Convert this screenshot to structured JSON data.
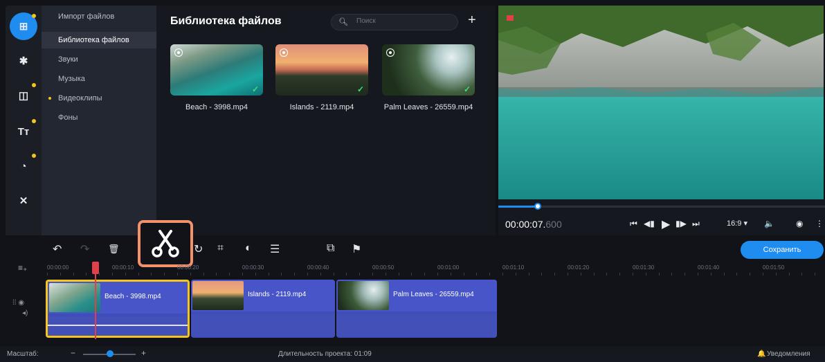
{
  "sidebar": {
    "icons": [
      {
        "name": "import-icon",
        "glyph": "⊞",
        "active": true,
        "dot": true
      },
      {
        "name": "pin-icon",
        "glyph": "✱",
        "active": false,
        "dot": false
      },
      {
        "name": "transitions-icon",
        "glyph": "◫",
        "active": false,
        "dot": true
      },
      {
        "name": "titles-icon",
        "glyph": "Tт",
        "active": false,
        "dot": true
      },
      {
        "name": "filters-icon",
        "glyph": "◔",
        "active": false,
        "dot": true
      },
      {
        "name": "tools-icon",
        "glyph": "✕",
        "active": false,
        "dot": false
      }
    ]
  },
  "categories": {
    "items": [
      {
        "label": "Импорт файлов"
      },
      {
        "label": "Библиотека файлов"
      },
      {
        "label": "Звуки"
      },
      {
        "label": "Музыка"
      },
      {
        "label": "Видеоклипы"
      },
      {
        "label": "Фоны"
      }
    ]
  },
  "library": {
    "title": "Библиотека файлов",
    "search_placeholder": "Поиск",
    "add_glyph": "+",
    "files": [
      {
        "name": "Beach - 3998.mp4"
      },
      {
        "name": "Islands - 2119.mp4"
      },
      {
        "name": "Palm Leaves - 26559.mp4"
      }
    ]
  },
  "player": {
    "time_main": "00:00:07.",
    "time_ms": "600",
    "progress": 0.12,
    "aspect": "16:9 ▾",
    "glyphs": {
      "prev": "⏮",
      "step_back": "◀▮",
      "play": "▶",
      "step_fwd": "▮▶",
      "next": "⏭",
      "volume": "🔈",
      "snapshot": "◉",
      "more": "⋮"
    }
  },
  "toolbar": {
    "undo": "↶",
    "redo": "↷",
    "delete": "🗑",
    "cut": "✂",
    "rotate": "↻",
    "crop": "⌗",
    "color": "◐",
    "settings": "☰",
    "overlay": "⧉",
    "marker": "⚑",
    "save_label": "Сохранить"
  },
  "timeline": {
    "add_track_glyph": "≡₊",
    "ticks": [
      "00:00:00",
      "00:00:10",
      "00:00:20",
      "00:00:30",
      "00:00:40",
      "00:00:50",
      "00:01:00",
      "00:01:10",
      "00:01:20",
      "00:01:30",
      "00:01:40",
      "00:01:50"
    ],
    "clips": [
      {
        "name": "Beach - 3998.mp4"
      },
      {
        "name": "Islands - 2119.mp4"
      },
      {
        "name": "Palm Leaves - 26559.mp4"
      }
    ]
  },
  "status": {
    "scale_label": "Масштаб:",
    "zoom_minus": "−",
    "zoom_plus": "+",
    "duration_text": "Длительность проекта: 01:09",
    "notifications": "Уведомления",
    "bell_glyph": "🔔"
  },
  "colors": {
    "accent": "#1f8df0",
    "highlight": "#f4906a",
    "selection": "#f5c518",
    "clip": "#4755c8"
  }
}
